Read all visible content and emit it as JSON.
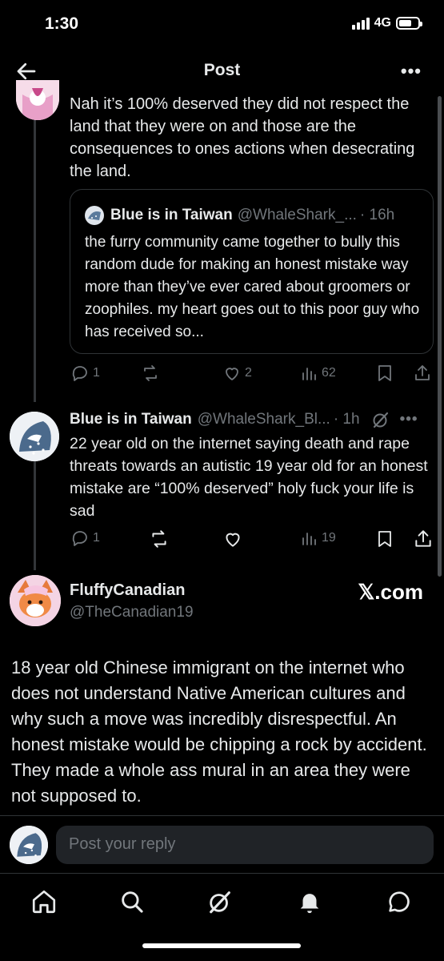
{
  "status_bar": {
    "time": "1:30",
    "network": "4G"
  },
  "header": {
    "title": "Post",
    "more": "•••"
  },
  "parent_tweet": {
    "text": "Nah it’s 100% deserved they did not respect the land that they were on and those are the consequences to ones actions when desecrating the land.",
    "quote": {
      "name": "Blue is in Taiwan",
      "handle": "@WhaleShark_...",
      "time": "· 16h",
      "text": "the furry community came together to bully this random dude for making an honest mistake way more than they’ve ever cared about groomers or zoophiles. my heart goes out to this poor guy who has received so..."
    },
    "replies": "1",
    "likes": "2",
    "views": "62"
  },
  "reply_tweet": {
    "name": "Blue is in Taiwan",
    "handle": "@WhaleShark_Bl...",
    "time": "· 1h",
    "text": "22 year old on the internet saying death and rape threats towards an autistic 19 year old for an honest mistake are “100% deserved” holy fuck your life is sad",
    "replies": "1",
    "views": "19",
    "more": "•••"
  },
  "main_tweet": {
    "name": "FluffyCanadian",
    "handle": "@TheCanadian19",
    "brand": "𝕏.com",
    "text": "18 year old Chinese immigrant on the internet who does not understand Native American cultures and why such a move was incredibly disrespectful. An honest mistake would be chipping a rock by accident. They made a whole ass mural in an area they were not supposed to."
  },
  "reply_box": {
    "placeholder": "Post your reply"
  },
  "icons": {
    "back": "arrow-left-icon",
    "home": "home-icon",
    "search": "search-icon",
    "grok": "grok-icon",
    "notifications": "bell-icon",
    "messages": "chat-bubble-icon"
  },
  "colors": {
    "background": "#000000",
    "text": "#e7e9ea",
    "muted": "#71767b",
    "border": "#2f3336"
  }
}
